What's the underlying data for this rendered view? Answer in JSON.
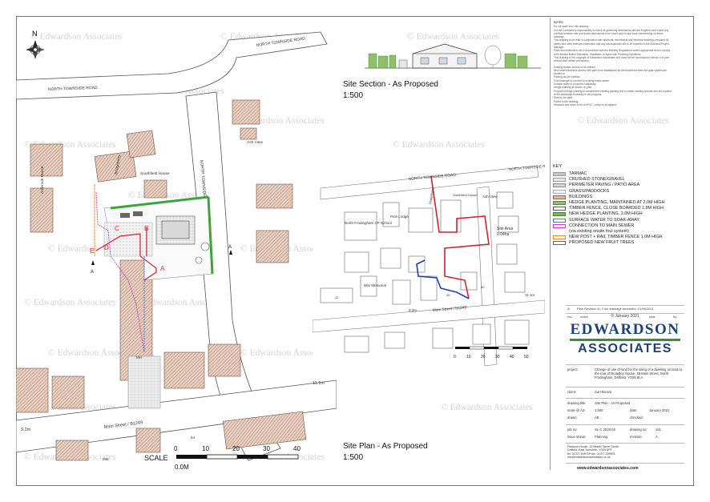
{
  "watermark": "© Edwardson Associates",
  "compass_n": "N",
  "road_labels": {
    "north_townside": "NORTH TOWNSIDE ROAD",
    "main_street": "Main Street / B1249",
    "location_main": "NORTH TOWNSIDE ROAD",
    "location_north_townside": "NORTH TOWNSIDE R.",
    "location_main_street": "Main Street / B1249"
  },
  "building_labels": {
    "southfield": "Southfield House",
    "ash_view": "Ash View",
    "ambrook": "Ambrook House",
    "bridgeberry": "Bridgeberry",
    "north_frodingham_school": "North Frodingham CP School",
    "pine_lodge": "Pine Lodge",
    "war_memorial": "War Memorial",
    "site_area": "Site Area",
    "site_area_value": "0.04ha",
    "num_49": "49",
    "num_50": "50",
    "num_42": "42",
    "num_54": "54",
    "num_28a": "28a",
    "num_28": "28"
  },
  "point_labels": {
    "a": "A",
    "b": "B",
    "c": "C",
    "d": "D",
    "e": "E",
    "section_a": "A",
    "section_a2": "A",
    "mh": "MH"
  },
  "levels": {
    "east": "11.1m",
    "west": "9.2m",
    "loc_east": "11.1m",
    "loc_west": "9.3m"
  },
  "scale_bar": {
    "label": "SCALE",
    "ticks": [
      "0",
      "10",
      "20",
      "30",
      "40"
    ],
    "unit_note": "0.0M"
  },
  "location_scale": {
    "ticks": [
      "0",
      "10",
      "20",
      "30",
      "40",
      "50"
    ]
  },
  "titles": {
    "section": "Site Section - As Proposed",
    "section_scale": "1:500",
    "plan": "Site Plan - As Proposed",
    "plan_scale": "1:500"
  },
  "notes": {
    "heading": "NOTES",
    "general": [
      "Do not scale from this drawing.",
      "It is the Contractor's responsibility to check all governing dimensions with the Engineer and report any conflicts between site and drawn dimensions to be found prior to any work commencing on these drawings.",
      "This drawing to be read in conjunction with structural, mechanical and electrical drawings prepared by others and other relevant information and any discrepancies are to be reported to the Architect/Project Manager.",
      "Plant and materials to be in accordance with the Building Regulations where appropriate and to comply with relevant British Standards, Installation to agree with Planning Conditions.",
      "This drawing is the copyright of Edwardson Associates and must not be reproduced in whole or in part without their written permission."
    ],
    "numbered": [
      "Existing tarmac access to be utilised.",
      "New small frameless access with gate to be established by bin/household trees are gate system are located to.",
      "Parking as per location.",
      "Foul drainage to connect to existing mains sewer.",
      "Surface water to proposed soakaway.",
      "Hedge planting as shown on plan.",
      "Proposed hedge planting to complement existing planting and to match existing species and are located to the landscape boundary in the proposal.",
      "Shed to be sited.",
      "Paved to the dwelling.",
      "Windows and doors to be of uPVC, colour to be agreed."
    ]
  },
  "key": {
    "title": "KEY",
    "items": [
      {
        "label": "TARMAC",
        "color": "#c7c7c7",
        "border": "#999999"
      },
      {
        "label": "CRUSHED STONE/GRAVEL",
        "color": "#eaeaea",
        "border": "#999999"
      },
      {
        "label": "PERIMETER PAVING / PATIO AREA",
        "color": "#d6d6d6",
        "border": "#888888"
      },
      {
        "label": "GRASS/PADDOCKS",
        "color": "#f4f4f4",
        "border": "#aaaaaa"
      },
      {
        "label": "BUILDINGS",
        "color": "#d9b8a6",
        "border": "#8c6a58"
      },
      {
        "label": "HEDGE PLANTING, MAINTAINED AT 2.0M HIGH",
        "color": "#8fbf6a",
        "border": "#4f8a38"
      },
      {
        "label": "TIMBER FENCE, CLOSE BOARDED 1.8M HIGH",
        "color": "#ffffff",
        "border": "#555555"
      },
      {
        "label": "NEW HEDGE PLANTING, 2.0M HIGH",
        "color": "#6cc24a",
        "border": "#2e8b22"
      },
      {
        "label": "SURFACE WATER TO SOAK-AWAY",
        "color": "#ffffff",
        "border": "#3b7ae0"
      },
      {
        "label": "CONNECTION TO MAIN SEWER",
        "color": "#ffffff",
        "border": "#d13ad1"
      },
      {
        "label": "(via existing onsite foul system)",
        "color": "",
        "border": ""
      },
      {
        "label": "NEW POST + RAIL TIMBER FENCE 1.0M HIGH",
        "color": "#ffffff",
        "border": "#e8872c"
      },
      {
        "label": "PROPOSED NEW FRUIT TREES",
        "color": "#ffffff",
        "border": "#666666"
      }
    ]
  },
  "revision_row": {
    "letter": "A",
    "text": "Plan Revision A - Foul drainage amended, 21/06/2021",
    "rev": "A"
  },
  "revision_head": {
    "rev": "rev.",
    "notes": "notes",
    "date": "date",
    "by": "by"
  },
  "copyright": "© January 2021",
  "logo": {
    "line1": "EDWARDSON",
    "line2": "ASSOCIATES"
  },
  "project": {
    "label": "project:",
    "text": "Change of use of land for the siting of a dwelling on land to the rear of Broadley House, 49 Main Street, North Frodingham, Driffield, YO25 8LA"
  },
  "client": {
    "label": "client:",
    "value": "Carl Bicock"
  },
  "drawing_title": {
    "label": "drawing title:",
    "value": "Site Plan - As Proposed"
  },
  "scale": {
    "label": "scale @ A3:",
    "value": "1:500"
  },
  "date": {
    "label": "date:",
    "value": "January 2021"
  },
  "drawn": {
    "label": "drawn:",
    "value": "AB"
  },
  "checked": {
    "label": "checked:",
    "value": ""
  },
  "job_no": {
    "label": "job no:",
    "value": "SL-C 2020.03"
  },
  "drawing_no": {
    "label": "drawing no:",
    "value": "101"
  },
  "issue_status": {
    "label": "issue status:",
    "value": "Planning"
  },
  "revision": {
    "label": "revision:",
    "value": "A"
  },
  "address": [
    "Paddock House, 10 Middle Street South",
    "Driffield, East Yorkshire, YO25 6PT",
    "tel: 01377 849709  fax: 01377 259003",
    "info@edwardsonassociates.co.uk"
  ],
  "website": "www.edwardsonassociates.com"
}
